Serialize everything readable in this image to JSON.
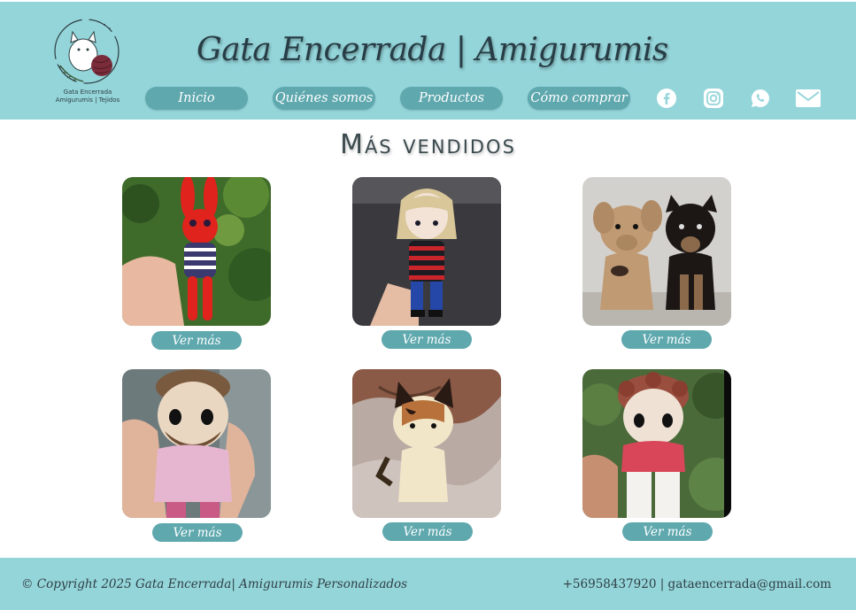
{
  "brand": {
    "logo_line1": "Gata Encerrada",
    "logo_line2": "Amigurumis | Tejidos",
    "title": "Gata Encerrada | Amigurumis"
  },
  "nav": {
    "items": [
      {
        "label": "Inicio"
      },
      {
        "label": "Quiénes somos"
      },
      {
        "label": "Productos"
      },
      {
        "label": "Cómo comprar"
      }
    ]
  },
  "social": [
    "facebook-icon",
    "instagram-icon",
    "whatsapp-icon",
    "mail-icon"
  ],
  "section": {
    "title": "Más vendidos"
  },
  "products": [
    {
      "image": "red-bunny-amigurumi",
      "button": "Ver más"
    },
    {
      "image": "blonde-doll-amigurumi",
      "button": "Ver más"
    },
    {
      "image": "two-dogs-amigurumi",
      "button": "Ver más"
    },
    {
      "image": "bearded-man-amigurumi",
      "button": "Ver más"
    },
    {
      "image": "calico-cat-amigurumi",
      "button": "Ver más"
    },
    {
      "image": "curly-hair-doll-amigurumi",
      "button": "Ver más"
    }
  ],
  "footer": {
    "copyright": "© Copyright 2025 Gata Encerrada| Amigurumis Personalizados",
    "contact": "+56958437920 | gataencerrada@gmail.com"
  },
  "colors": {
    "header_bg": "#94d5da",
    "button_bg": "#5ea8ae",
    "title_text": "#283d45"
  }
}
